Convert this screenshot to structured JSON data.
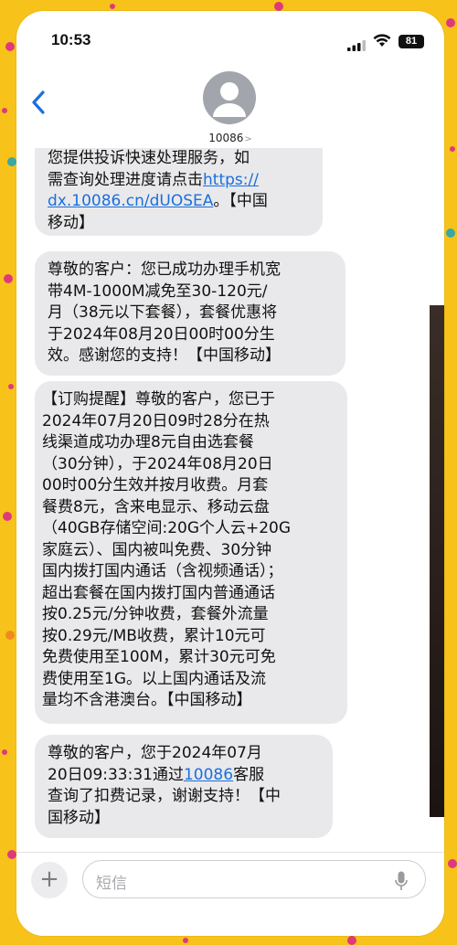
{
  "status": {
    "time": "10:53",
    "battery": "81"
  },
  "header": {
    "contact": "10086"
  },
  "messages": [
    {
      "lines": [
        "您提供投诉快速处理服务，如",
        "需查询处理进度请点击",
        "。【中国",
        "移动】"
      ],
      "link": "https://dx.10086.cn/dUOSEA",
      "link_parts": [
        "https://",
        "dx.10086.cn/dUOSEA"
      ]
    },
    {
      "lines": [
        "尊敬的客户：您已成功办理手机宽",
        "带4M-1000M减免至30-120元/",
        "月（38元以下套餐），套餐优惠将",
        "于2024年08月20日00时00分生",
        "效。感谢您的支持！【中国移动】"
      ]
    },
    {
      "lines": [
        "【订购提醒】尊敬的客户，您已于",
        "2024年07月20日09时28分在热",
        "线渠道成功办理8元自由选套餐",
        "（30分钟），于2024年08月20日",
        "00时00分生效并按月收费。月套",
        "餐费8元，含来电显示、移动云盘",
        "（40GB存储空间:20G个人云+20G",
        "家庭云）、国内被叫免费、30分钟",
        "国内拨打国内通话（含视频通话）；",
        "超出套餐在国内拨打国内普通通话",
        "按0.25元/分钟收费，套餐外流量",
        "按0.29元/MB收费，累计10元可",
        "免费使用至100M，累计30元可免",
        "费使用至1G。以上国内通话及流",
        "量均不含港澳台。【中国移动】"
      ]
    },
    {
      "lines": [
        "尊敬的客户，您于2024年07月",
        "20日09:33:31通过",
        "客服",
        "查询了扣费记录，谢谢支持！【中",
        "国移动】"
      ],
      "link": "10086"
    }
  ],
  "composer": {
    "placeholder": "短信"
  },
  "colors": {
    "background": "#f7c31a",
    "bubble": "#e9e9eb",
    "link": "#1a6fdc",
    "accent": "#1a6fdc"
  }
}
